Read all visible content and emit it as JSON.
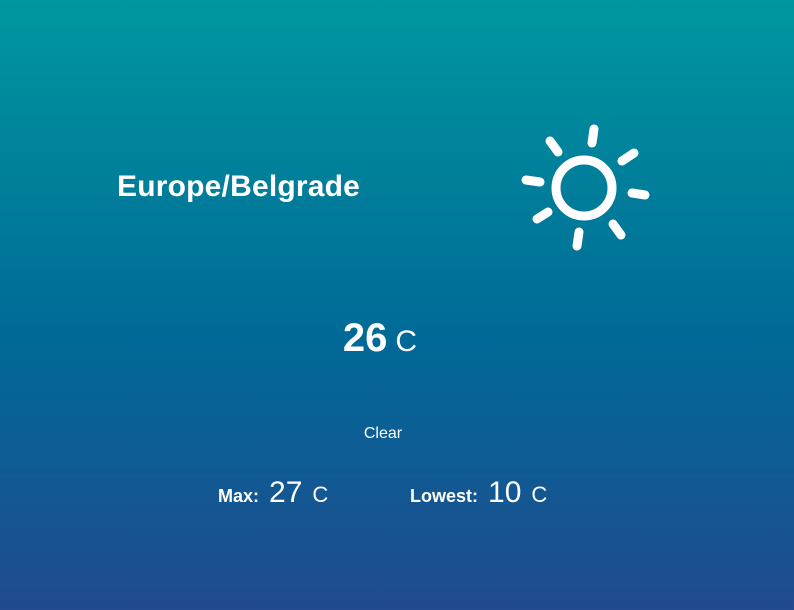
{
  "location": "Europe/Belgrade",
  "weather_icon": "sun-icon",
  "current": {
    "temperature": "26",
    "unit": "C"
  },
  "condition": "Clear",
  "max": {
    "label": "Max:",
    "value": "27",
    "unit": "C"
  },
  "lowest": {
    "label": "Lowest:",
    "value": "10",
    "unit": "C"
  },
  "colors": {
    "gradient_top": "#00979f",
    "gradient_mid": "#006a97",
    "gradient_bottom": "#214a8f",
    "text": "#ffffff"
  }
}
